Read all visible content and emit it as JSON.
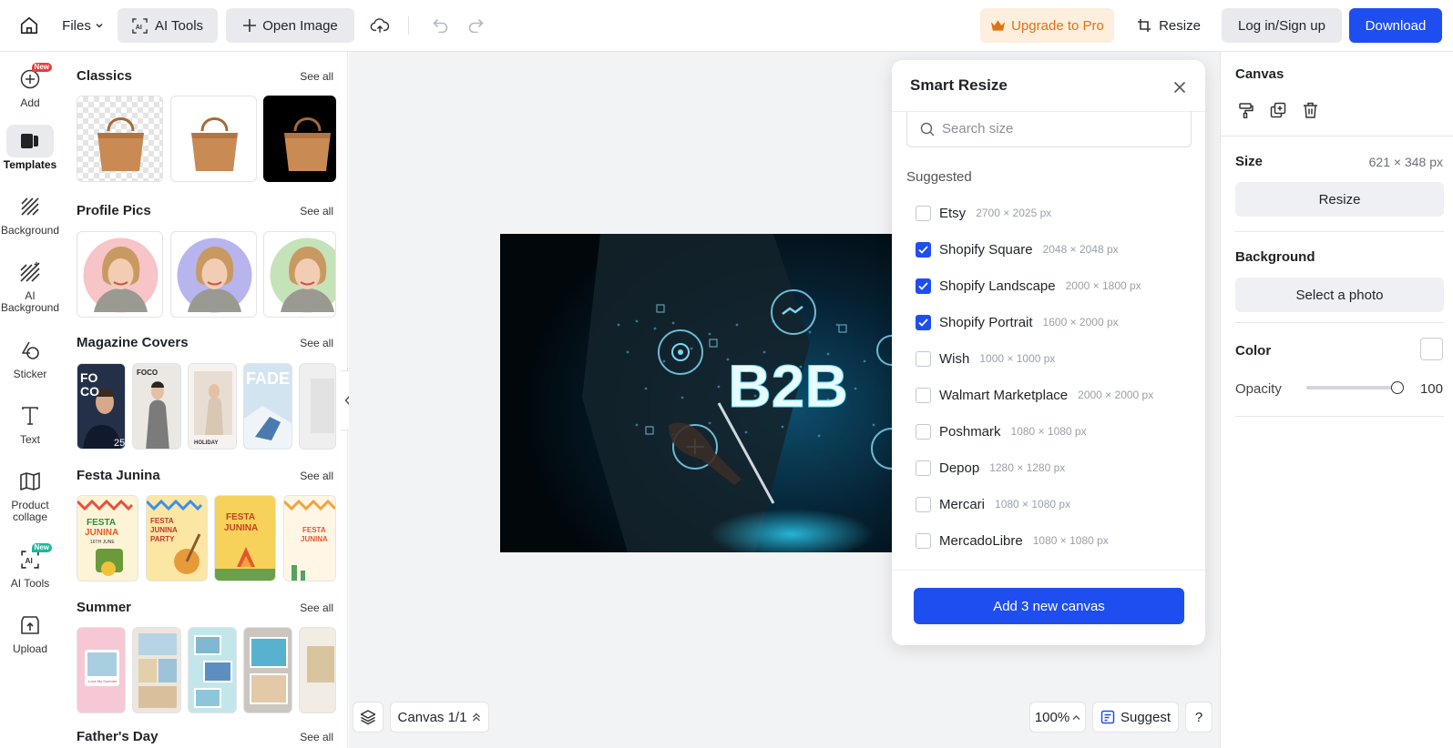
{
  "topbar": {
    "files_label": "Files",
    "ai_tools_label": "AI Tools",
    "open_image_label": "Open Image",
    "upgrade_label": "Upgrade to Pro",
    "resize_label": "Resize",
    "login_label": "Log in/Sign up",
    "download_label": "Download"
  },
  "rail": {
    "items": [
      {
        "label": "Add",
        "icon": "plus-circle-icon",
        "badge": "New"
      },
      {
        "label": "Templates",
        "icon": "templates-icon",
        "active": true
      },
      {
        "label": "Background",
        "icon": "hatch-icon"
      },
      {
        "label": "AI Background",
        "icon": "ai-hatch-icon"
      },
      {
        "label": "Sticker",
        "icon": "sticker-icon"
      },
      {
        "label": "Text",
        "icon": "text-icon"
      },
      {
        "label": "Product collage",
        "icon": "collage-icon"
      },
      {
        "label": "AI Tools",
        "icon": "ai-tools-icon",
        "badge": "New"
      },
      {
        "label": "Upload",
        "icon": "upload-icon"
      }
    ]
  },
  "templates": {
    "see_all": "See all",
    "sections": [
      {
        "title": "Classics"
      },
      {
        "title": "Profile Pics"
      },
      {
        "title": "Magazine Covers"
      },
      {
        "title": "Festa Junina"
      },
      {
        "title": "Summer"
      },
      {
        "title": "Father's Day"
      }
    ],
    "magazine_texts": {
      "foco": "FO CO",
      "foco_small": "FOCO",
      "holiday": "HOLIDAY",
      "fade": "FADE",
      "issue": "25"
    },
    "festa_texts": {
      "festa": "FESTA JUNINA",
      "date": "16TH JUNE",
      "party": "FESTA JUNINA PARTY"
    },
    "summer_texts": {
      "caption": "Love My Summer"
    }
  },
  "canvas": {
    "image_text": "B2B",
    "canvas_label": "Canvas 1/1",
    "zoom": "100%",
    "suggest_label": "Suggest",
    "help_label": "?"
  },
  "smart_resize": {
    "title": "Smart Resize",
    "search_placeholder": "Search size",
    "suggested_label": "Suggested",
    "options": [
      {
        "name": "Etsy",
        "size": "2700 × 2025 px",
        "checked": false
      },
      {
        "name": "Shopify Square",
        "size": "2048 × 2048 px",
        "checked": true
      },
      {
        "name": "Shopify Landscape",
        "size": "2000 × 1800 px",
        "checked": true
      },
      {
        "name": "Shopify Portrait",
        "size": "1600 × 2000 px",
        "checked": true
      },
      {
        "name": "Wish",
        "size": "1000 × 1000 px",
        "checked": false
      },
      {
        "name": "Walmart Marketplace",
        "size": "2000 × 2000 px",
        "checked": false
      },
      {
        "name": "Poshmark",
        "size": "1080 × 1080 px",
        "checked": false
      },
      {
        "name": "Depop",
        "size": "1280 × 1280 px",
        "checked": false
      },
      {
        "name": "Mercari",
        "size": "1080 × 1080 px",
        "checked": false
      },
      {
        "name": "MercadoLibre",
        "size": "1080 × 1080 px",
        "checked": false
      }
    ],
    "add_button_label": "Add 3 new canvas"
  },
  "right_panel": {
    "canvas_title": "Canvas",
    "size_label": "Size",
    "size_value": "621 × 348 px",
    "resize_label": "Resize",
    "background_label": "Background",
    "select_photo_label": "Select a photo",
    "color_label": "Color",
    "color_value": "#ffffff",
    "opacity_label": "Opacity",
    "opacity_value": "100",
    "opacity_fraction": 1.0
  },
  "colors": {
    "accent": "#1f4ef0",
    "upgrade_bg": "#fdeedd",
    "upgrade_text": "#e0730f",
    "badge_red": "#ef3b3b",
    "badge_green": "#1cb89a"
  }
}
